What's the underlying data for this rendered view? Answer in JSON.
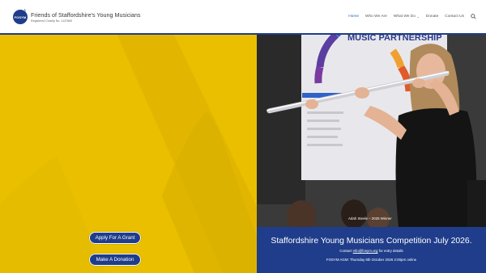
{
  "header": {
    "logo_badge": "FOSYM",
    "title": "Friends of Staffordshire's Young Musicians",
    "subtitle": "Registered Charity No. 1137660",
    "nav": [
      {
        "label": "Home",
        "active": true,
        "dropdown": false
      },
      {
        "label": "Who We Are",
        "active": false,
        "dropdown": false
      },
      {
        "label": "What We Do",
        "active": false,
        "dropdown": true
      },
      {
        "label": "Donate",
        "active": false,
        "dropdown": false
      },
      {
        "label": "Contact Us",
        "active": false,
        "dropdown": false
      }
    ],
    "search_icon": "search-icon"
  },
  "hero": {
    "apply_label": "Apply For A Grant",
    "donation_label": "Make A Donation",
    "photo_caption": "Adah Steele – 2025 Winner",
    "photo_sign_text": "MUSIC PARTNERSHIP"
  },
  "info": {
    "title": "Staffordshire Young Musicians Competition July 2026.",
    "contact_prefix": "Contact ",
    "contact_email": "info@fosym.org",
    "contact_suffix": " for entry details",
    "agm": "FOSYM AGM: Thursday 8th October 2026 2:00pm online"
  },
  "colors": {
    "brand_blue": "#1f3d8a",
    "hero_yellow": "#e9bf00",
    "nav_active": "#2a62b8"
  }
}
